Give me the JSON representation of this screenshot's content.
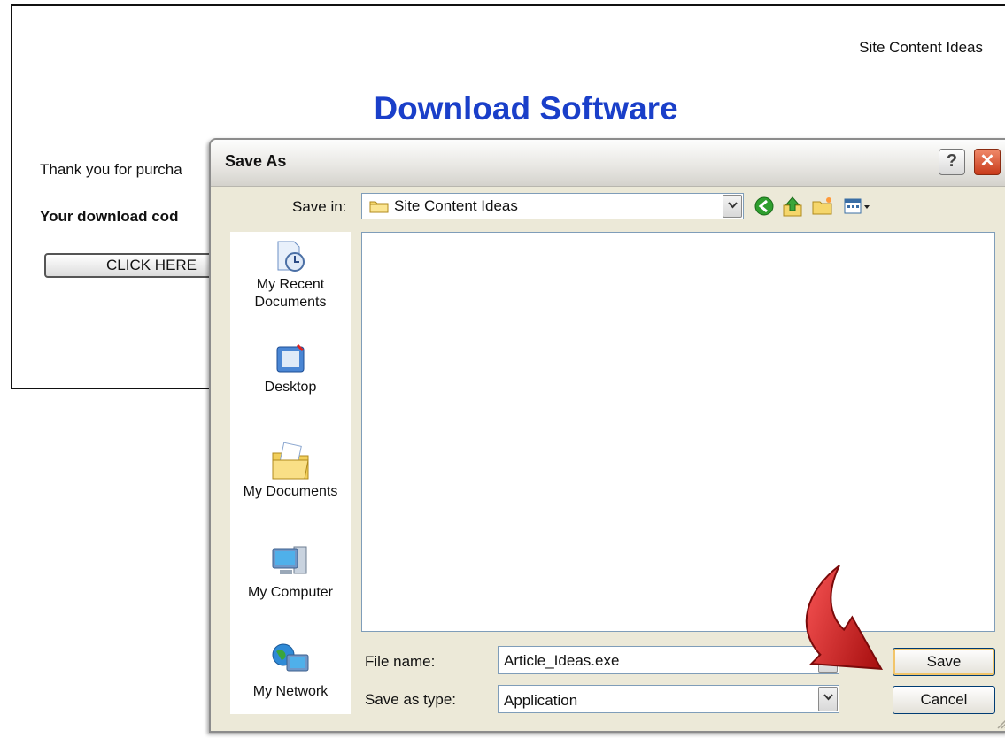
{
  "page": {
    "site_name": "Site Content Ideas",
    "title": "Download Software",
    "thanks_text": "Thank you for purcha",
    "code_text": "Your download cod",
    "click_button": "CLICK HERE",
    "title_color": "#1a3fc9"
  },
  "dialog": {
    "title": "Save As",
    "help_glyph": "?",
    "close_glyph": "✕",
    "save_in_label": "Save in:",
    "save_in_value": "Site Content Ideas",
    "toolbar_icons": [
      "back-icon",
      "up-folder-icon",
      "new-folder-icon",
      "views-menu-icon"
    ],
    "places": [
      {
        "label_line1": "My Recent",
        "label_line2": "Documents",
        "icon": "recent-documents-icon"
      },
      {
        "label_line1": "Desktop",
        "label_line2": "",
        "icon": "desktop-icon"
      },
      {
        "label_line1": "My Documents",
        "label_line2": "",
        "icon": "my-documents-icon"
      },
      {
        "label_line1": "My Computer",
        "label_line2": "",
        "icon": "my-computer-icon"
      },
      {
        "label_line1": "My Network",
        "label_line2": "",
        "icon": "my-network-icon"
      }
    ],
    "file_name_label": "File name:",
    "file_name_value": "Article_Ideas.exe",
    "save_type_label": "Save as type:",
    "save_type_value": "Application",
    "save_button": "Save",
    "cancel_button": "Cancel"
  },
  "annotation": {
    "icon": "red-curved-arrow-icon",
    "color": "#d81e1e"
  }
}
